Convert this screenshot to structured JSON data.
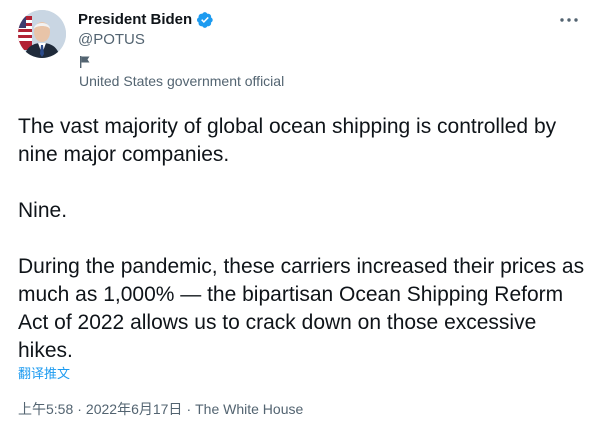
{
  "author": {
    "display_name": "President Biden",
    "handle": "@POTUS",
    "affiliation": "United States government official",
    "verified": true
  },
  "tweet": {
    "paragraphs": [
      "The vast majority of global ocean shipping is controlled by nine major companies.",
      "Nine.",
      "During the pandemic, these carriers increased their prices as much as 1,000% — the bipartisan Ocean Shipping Reform Act of 2022 allows us to crack down on those excessive hikes."
    ],
    "translate_label": "翻译推文"
  },
  "meta": {
    "time": "上午5:58",
    "separator": "·",
    "date": "2022年6月17日",
    "source": "The White House"
  },
  "icons": {
    "more": "more-dots-icon",
    "verified": "verified-badge-icon",
    "flag": "flag-icon"
  },
  "colors": {
    "text_primary": "#0f1419",
    "text_secondary": "#536471",
    "accent": "#1d9bf0"
  }
}
